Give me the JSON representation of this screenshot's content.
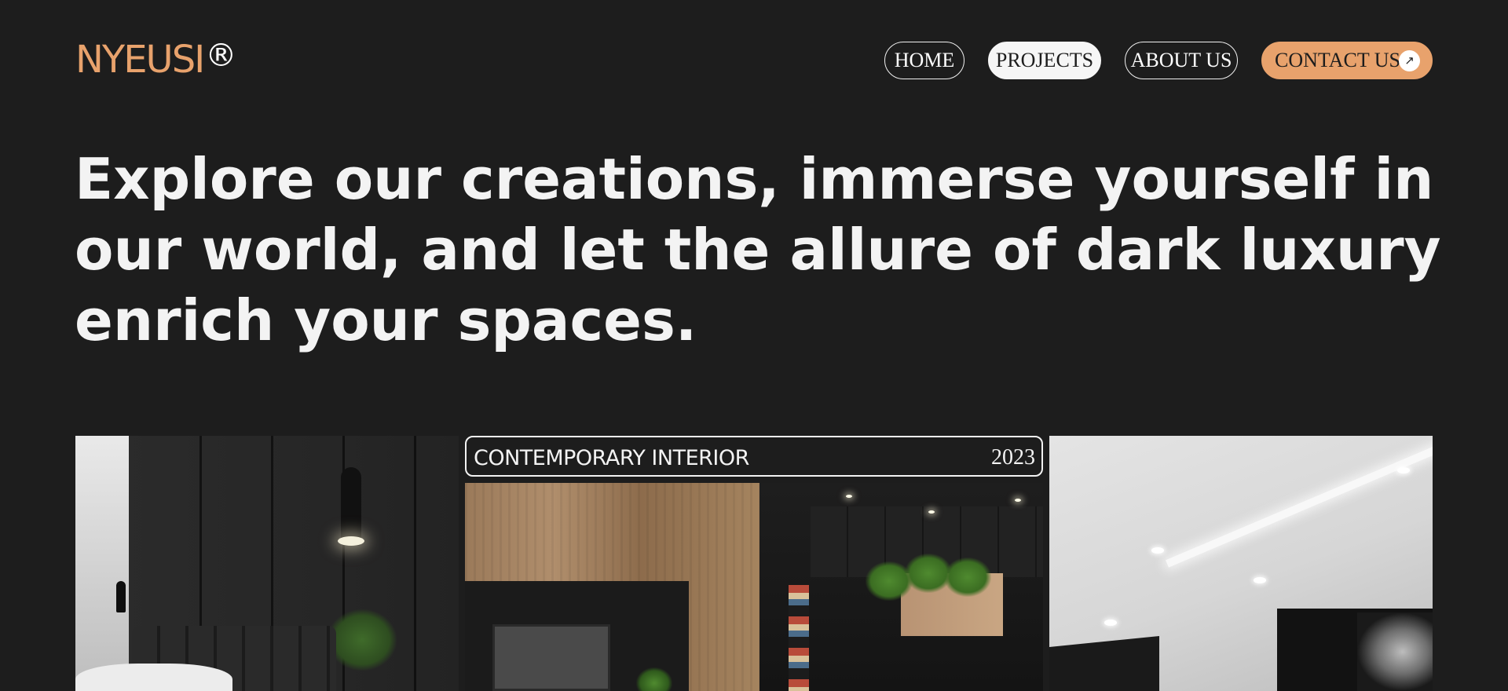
{
  "brand": {
    "name": "NYEUSI",
    "registered_mark": "®"
  },
  "nav": {
    "home": "HOME",
    "projects": "PROJECTS",
    "about": "ABOUT US",
    "contact": "CONTACT US",
    "contact_icon": "arrow-up-right-icon",
    "active": "PROJECTS"
  },
  "hero": {
    "headline": "Explore our creations, immerse yourself in our world, and let the allure of dark luxury enrich your spaces."
  },
  "gallery": {
    "featured": {
      "title": "CONTEMPORARY INTERIOR",
      "year": "2023"
    }
  },
  "colors": {
    "background": "#1d1d1d",
    "accent": "#e8a26c",
    "text": "#f3f3f3"
  }
}
